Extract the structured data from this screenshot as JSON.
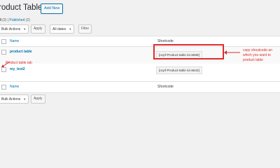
{
  "header": {
    "title": "roduct Table",
    "add_new_label": "Add New"
  },
  "views": {
    "all_label": "ll",
    "all_count": "(2)",
    "separator": "|",
    "published_label": "Published",
    "published_count": "(2)"
  },
  "toolbar_top": {
    "bulk_actions_value": "Bulk Actions",
    "apply_label": "Apply",
    "date_filter_value": "All dates",
    "filter_label": "Filter"
  },
  "table": {
    "columns": {
      "name": "Name",
      "shortcode": "Shortcode"
    },
    "rows": [
      {
        "name": "product table",
        "shortcode": "[ocpf-Product-table id=5658]"
      },
      {
        "name": "my_test2",
        "shortcode": "[ocpf-Product-table id=5642]"
      }
    ],
    "footer_columns": {
      "name": "Name",
      "shortcode": "Shortcode"
    }
  },
  "toolbar_bottom": {
    "bulk_actions_value": "Bulk Actions",
    "apply_label": "Apply"
  },
  "annotations": {
    "arrow_left_label": "Product table tab",
    "right_note_lines": [
      "copy shoutcode an",
      "which you want to",
      "product table"
    ],
    "accent_color": "#e02c2c"
  }
}
